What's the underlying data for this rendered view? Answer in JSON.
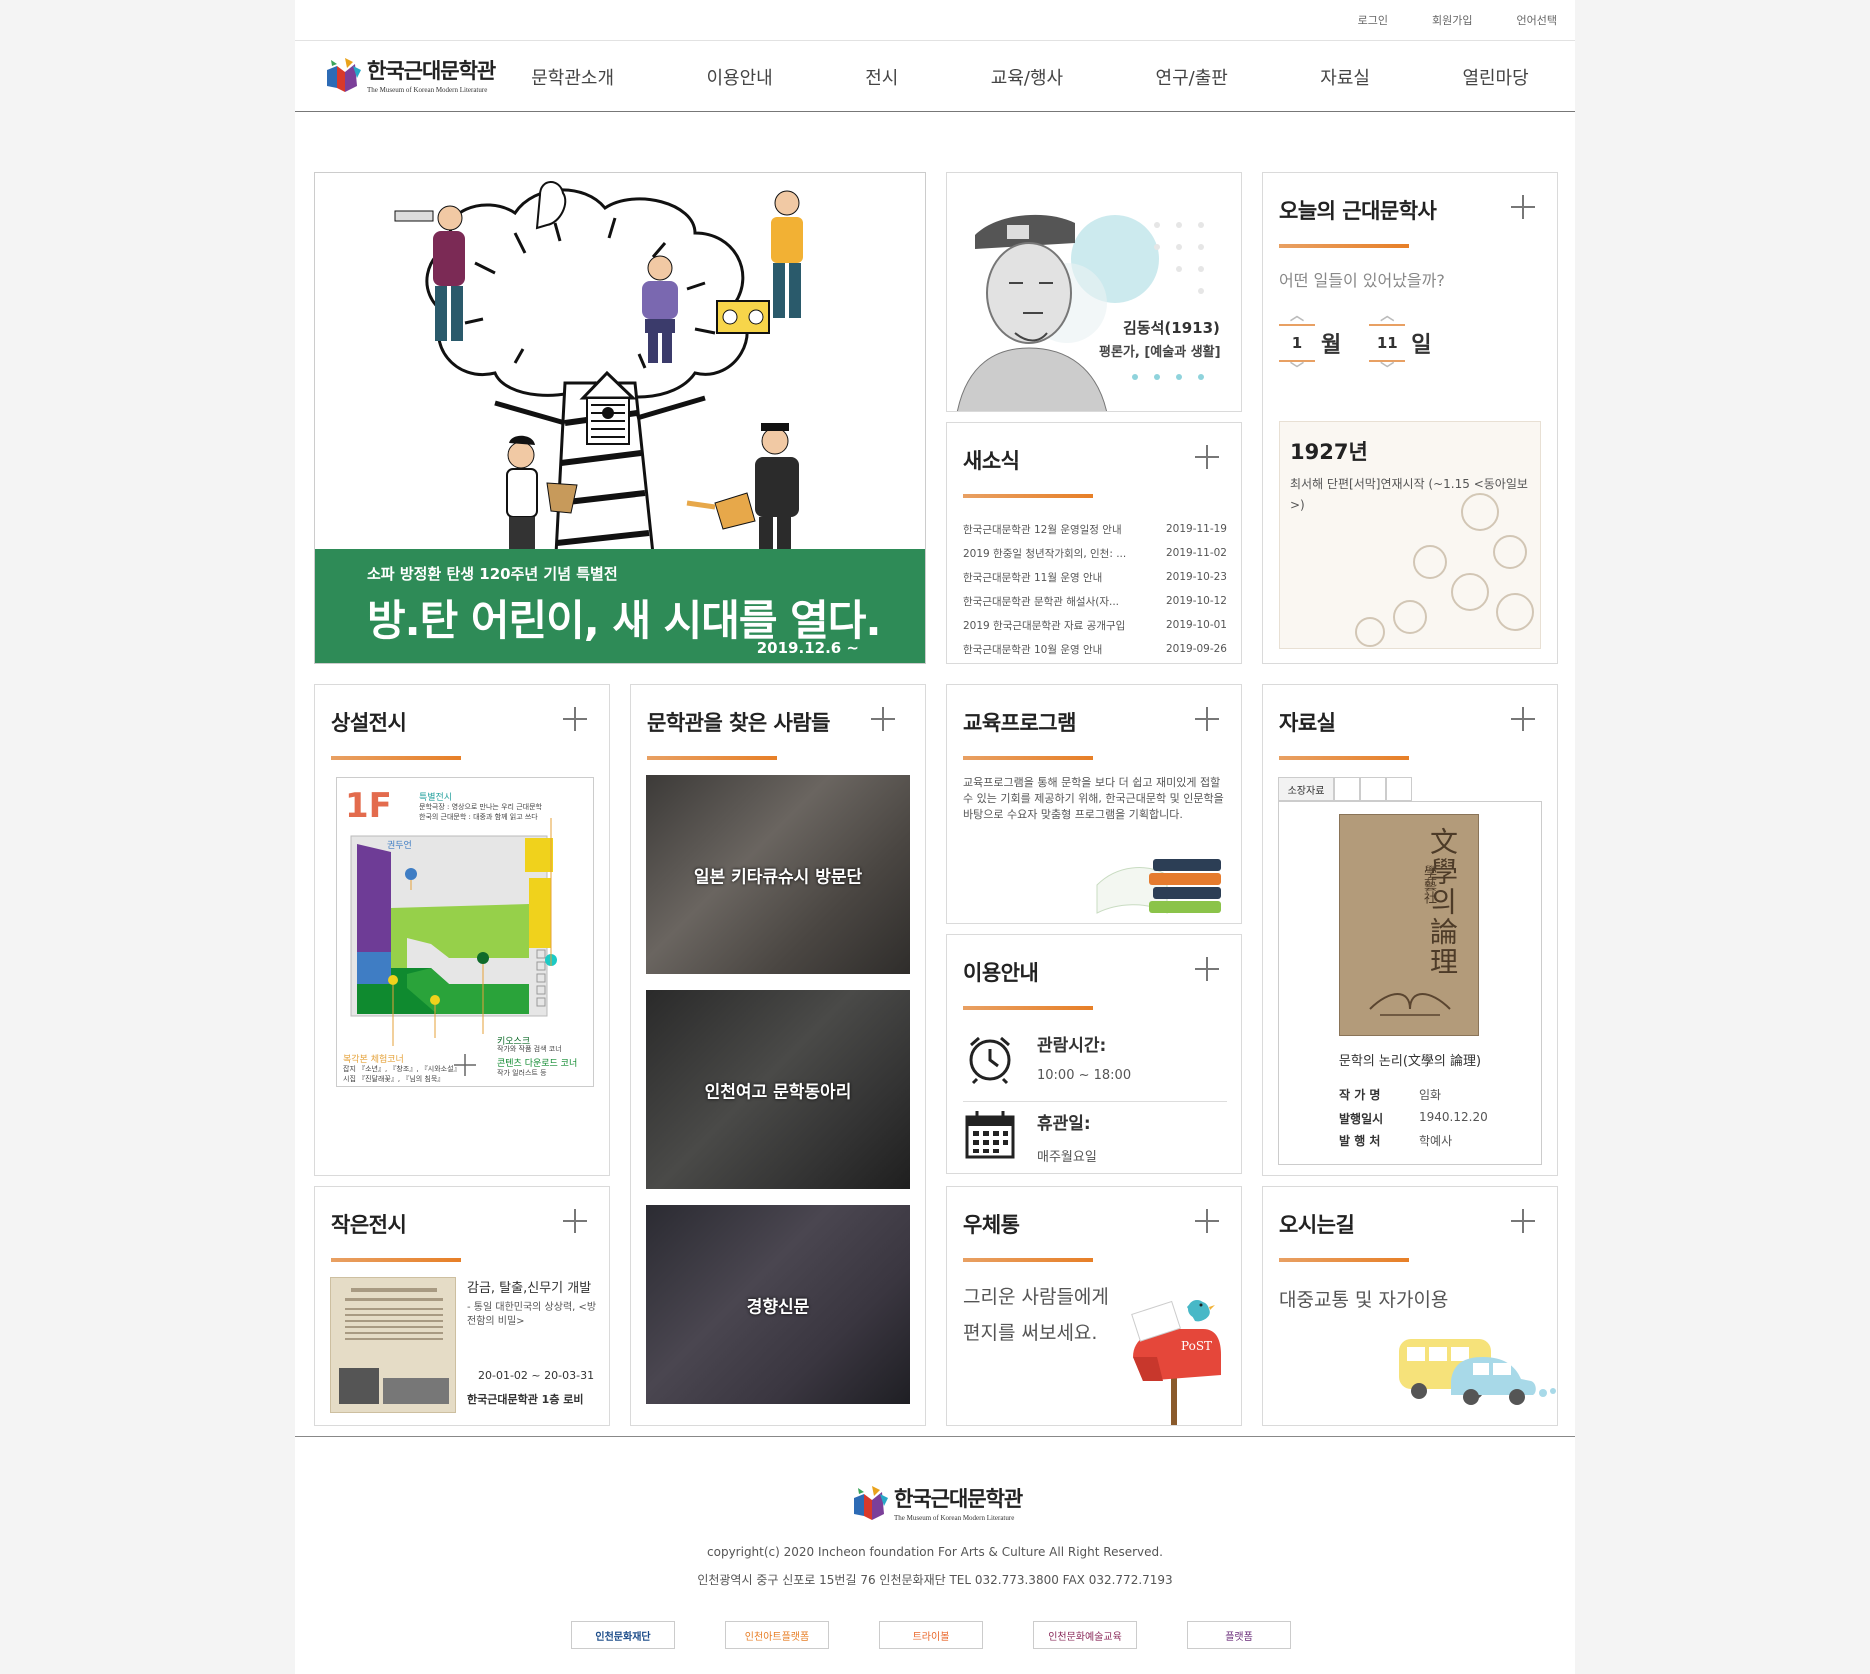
{
  "util": {
    "login": "로그인",
    "join": "회원가입",
    "lang": "언어선택"
  },
  "logo": {
    "ko": "한국근대문학관",
    "en": "The Museum of Korean Modern Literature"
  },
  "menu": [
    "문학관소개",
    "이용안내",
    "전시",
    "교육/행사",
    "연구/출판",
    "자료실",
    "열린마당"
  ],
  "banner": {
    "sub": "소파 방정환 탄생 120주년 기념 특별전",
    "main": "방.탄 어린이, 새 시대를 열다.",
    "date": "2019.12.6 ~"
  },
  "portrait": {
    "name": "김동석(1913)",
    "desc": "평론가, [예술과 생활]"
  },
  "news": {
    "title": "새소식",
    "items": [
      {
        "title": "한국근대문학관 12월 운영일정 안내",
        "date": "2019-11-19"
      },
      {
        "title": "2019 한중일 청년작가회의, 인천: ...",
        "date": "2019-11-02"
      },
      {
        "title": "한국근대문학관 11월 운영 안내",
        "date": "2019-10-23"
      },
      {
        "title": "한국근대문학관 문학관 해설사(자...",
        "date": "2019-10-12"
      },
      {
        "title": "2019 한국근대문학관 자료 공개구입",
        "date": "2019-10-01"
      },
      {
        "title": "한국근대문학관 10월 운영 안내",
        "date": "2019-09-26"
      }
    ]
  },
  "today": {
    "title": "오늘의 근대문학사",
    "question": "어떤 일들이 있어났을까?",
    "month": "1",
    "month_unit": "월",
    "day": "11",
    "day_unit": "일",
    "year": "1927년",
    "desc": "최서해 단편[서막]연재시작 (~1.15 <동아일보>)"
  },
  "permanent": {
    "title": "상설전시",
    "floor": "1F",
    "labels": {
      "special": "특별전시",
      "special_desc1": "문학극장 : 영상으로 만나는 우리 근대문학",
      "special_desc2": "한국의 근대문학 : 대중과 함께 읽고 쓰다",
      "reading": "권두언",
      "kiosk": "키오스크",
      "kiosk_desc": "작가와 작품 검색 코너",
      "replica": "복각본 체험코너",
      "replica_desc1": "잡지 『소년』, 『창조』, 『시와소설』",
      "replica_desc2": "시집 『진달래꽃』, 『님의 침묵』",
      "download": "콘텐츠 다운로드 코너",
      "download_desc": "작가 일러스트 등"
    }
  },
  "visitors": {
    "title": "문학관을 찾은 사람들",
    "items": [
      "일본 키타큐슈시 방문단",
      "인천여고 문학동아리",
      "경향신문"
    ]
  },
  "education": {
    "title": "교육프로그램",
    "text": "교육프로그램을 통해 문학을 보다 더 쉽고 재미있게 접할 수 있는 기회를 제공하기 위해, 한국근대문학 및 인문학을 바탕으로 수요자 맞춤형 프로그램을 기획합니다."
  },
  "usage": {
    "title": "이용안내",
    "hours_label": "관람시간:",
    "hours": "10:00 ~ 18:00",
    "closed_label": "휴관일:",
    "closed": "매주월요일"
  },
  "library": {
    "title": "자료실",
    "tab": "소장자료",
    "book_title_v": "文學의論理",
    "book_pub_v": "學藝社",
    "caption": "문학의 논리(文學의 論理)",
    "author_label": "작 가 명",
    "author": "임화",
    "date_label": "발행일시",
    "date": "1940.12.20",
    "publisher_label": "발 행 처",
    "publisher": "학예사"
  },
  "small": {
    "title": "작은전시",
    "ex_title": "감금, 탈출,신무기 개발",
    "ex_sub": "- 통일 대한민국의 상상력, <방전함의 비밀>",
    "date": "20-01-02 ~ 20-03-31",
    "place": "한국근대문학관 1층 로비"
  },
  "mailbox": {
    "title": "우체통",
    "line1": "그리운 사람들에게",
    "line2": "편지를 써보세요.",
    "post": "PoST"
  },
  "directions": {
    "title": "오시는길",
    "text": "대중교통 및 자가이용"
  },
  "footer": {
    "copyright": "copyright(c) 2020 Incheon foundation For Arts & Culture All Right Reserved.",
    "address": "인천광역시 중구 신포로 15번길 76 인천문화재단 TEL 032.773.3800 FAX 032.772.7193",
    "partners": [
      "인천문화재단",
      "인천아트플랫폼",
      "트라이볼",
      "인천문화예술교육",
      "플랫폼"
    ]
  }
}
